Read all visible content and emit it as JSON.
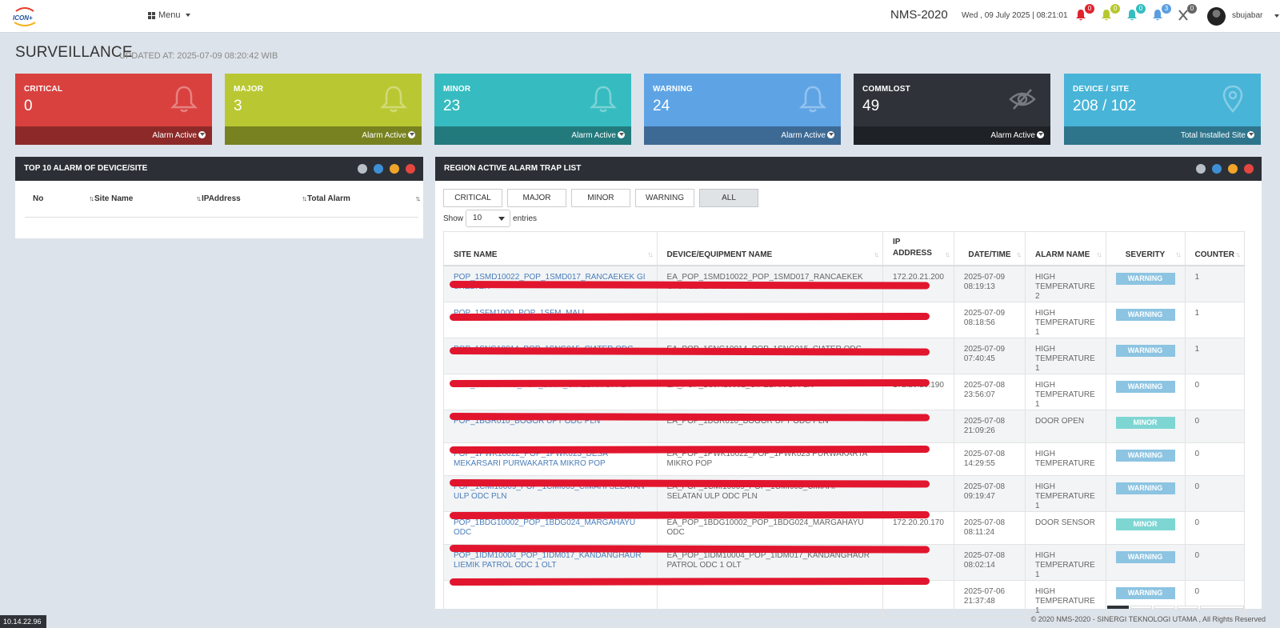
{
  "topbar": {
    "menu_label": "Menu",
    "brand": "NMS-2020",
    "datetime": "Wed , 09 July 2025 | 08:21:01",
    "username": "sbujabar",
    "notifications": [
      {
        "icon": "bell-icon",
        "count": "0",
        "color": "#e0232e"
      },
      {
        "icon": "bell-icon",
        "count": "0",
        "color": "#b7c82e"
      },
      {
        "icon": "bell-icon",
        "count": "0",
        "color": "#35bdc0"
      },
      {
        "icon": "bell-icon",
        "count": "3",
        "color": "#5b9ee0"
      },
      {
        "icon": "commlost-icon",
        "count": "0",
        "color": "#666666"
      }
    ]
  },
  "page": {
    "title": "SURVEILLANCE",
    "updated": "UPDATED AT: 2025-07-09 08:20:42 WIB"
  },
  "cards": [
    {
      "label": "CRITICAL",
      "value": "0",
      "footer": "Alarm Active",
      "color": "#d9413f",
      "icon": "bell-icon"
    },
    {
      "label": "MAJOR",
      "value": "3",
      "footer": "Alarm Active",
      "color": "#b9c832",
      "icon": "bell-icon"
    },
    {
      "label": "MINOR",
      "value": "23",
      "footer": "Alarm Active",
      "color": "#36bcc0",
      "icon": "bell-icon"
    },
    {
      "label": "WARNING",
      "value": "24",
      "footer": "Alarm Active",
      "color": "#5ea4e5",
      "icon": "bell-icon"
    },
    {
      "label": "COMMLOST",
      "value": "49",
      "footer": "Alarm Active",
      "color": "#2f3339",
      "icon": "eye-slash-icon"
    },
    {
      "label": "DEVICE / SITE",
      "value": "208 / 102",
      "footer": "Total Installed Site",
      "color": "#48b4d8",
      "icon": "map-marker-icon"
    }
  ],
  "top10": {
    "title": "TOP 10 ALARM OF DEVICE/SITE",
    "columns": [
      "No",
      "Site Name",
      "IPAddress",
      "Total Alarm"
    ]
  },
  "alarm_panel": {
    "title": "REGION ACTIVE ALARM TRAP LIST",
    "filters": [
      "CRITICAL",
      "MAJOR",
      "MINOR",
      "WARNING",
      "ALL"
    ],
    "active_filter": "ALL",
    "show_label": "Show",
    "entries_value": "10",
    "entries_label": "entries",
    "columns": [
      "SITE NAME",
      "DEVICE/EQUIPMENT NAME",
      "IP ADDRESS",
      "DATE/TIME",
      "ALARM NAME",
      "SEVERITY",
      "COUNTER"
    ],
    "rows": [
      {
        "site": "POP_1SMD10022_POP_1SMD017_RANCAEKEK GI SHELTER",
        "device": "EA_POP_1SMD10022_POP_1SMD017_RANCAEKEK GI SHELTER PLN",
        "ip": "172.20.21.200",
        "date": "2025-07-09",
        "time": "08:19:13",
        "alarm1": "HIGH",
        "alarm2": "TEMPERATURE 2",
        "severity": "WARNING",
        "counter": "1"
      },
      {
        "site": "POP_1SFM1000_POP_1SFM_MALL",
        "device": "",
        "ip": "",
        "date": "2025-07-09",
        "time": "08:18:56",
        "alarm1": "HIGH",
        "alarm2": "TEMPERATURE 1",
        "severity": "WARNING",
        "counter": "1"
      },
      {
        "site": "POP_1SNG10014_POP_1SNG015_CIATER ODC",
        "device": "EA_POP_1SNG10014_POP_1SNG015_CIATER ODC",
        "ip": "",
        "date": "2025-07-09",
        "time": "07:40:45",
        "alarm1": "HIGH",
        "alarm2": "TEMPERATURE 1",
        "severity": "WARNING",
        "counter": "1"
      },
      {
        "site": "POP_1CJR10002_POP_1CJR_CIPEDAK GI PLN",
        "device": "EA_POP_1CJR10002_CIPEDAK GI PLN",
        "ip": "172.20.20.190",
        "date": "2025-07-08",
        "time": "23:56:07",
        "alarm1": "HIGH",
        "alarm2": "TEMPERATURE 1",
        "severity": "WARNING",
        "counter": "0"
      },
      {
        "site": "POP_1BGR010_BOGOR UPT ODC PLN",
        "device": "EA_POP_1BGR010_BOGOR UPT ODC PLN",
        "ip": "",
        "date": "2025-07-08",
        "time": "21:09:26",
        "alarm1": "DOOR OPEN",
        "alarm2": "",
        "severity": "MINOR",
        "counter": "0"
      },
      {
        "site": "POP_1PWK10022_POP_1PWK023_DESA MEKARSARI PURWAKARTA MIKRO POP",
        "device": "EA_POP_1PWK10022_POP_1PWK023 PURWAKARTA MIKRO POP",
        "ip": "",
        "date": "2025-07-08",
        "time": "14:29:55",
        "alarm1": "HIGH",
        "alarm2": "TEMPERATURE",
        "severity": "WARNING",
        "counter": "0"
      },
      {
        "site": "POP_1CMI10009_POP_1CMI005_CIMAHI SELATAN ULP ODC PLN",
        "device": "EA_POP_1CMI10009_POP_1CMI005_CIMAHI SELATAN ULP ODC PLN",
        "ip": "",
        "date": "2025-07-08",
        "time": "09:19:47",
        "alarm1": "HIGH",
        "alarm2": "TEMPERATURE 1",
        "severity": "WARNING",
        "counter": "0"
      },
      {
        "site": "POP_1BDG10002_POP_1BDG024_MARGAHAYU ODC",
        "device": "EA_POP_1BDG10002_POP_1BDG024_MARGAHAYU ODC",
        "ip": "172.20.20.170",
        "date": "2025-07-08",
        "time": "08:11:24",
        "alarm1": "DOOR SENSOR",
        "alarm2": "",
        "severity": "MINOR",
        "counter": "0"
      },
      {
        "site": "POP_1IDM10004_POP_1IDM017_KANDANGHAUR LIEMIK PATROL ODC 1 OLT",
        "device": "EA_POP_1IDM10004_POP_1IDM017_KANDANGHAUR PATROL ODC 1 OLT",
        "ip": "",
        "date": "2025-07-08",
        "time": "08:02:14",
        "alarm1": "HIGH",
        "alarm2": "TEMPERATURE 1",
        "severity": "WARNING",
        "counter": "0"
      },
      {
        "site": "",
        "device": "",
        "ip": "",
        "date": "2025-07-06",
        "time": "21:37:48",
        "alarm1": "HIGH",
        "alarm2": "TEMPERATURE 1",
        "severity": "WARNING",
        "counter": "0"
      }
    ],
    "severity_colors": {
      "WARNING": "#8cc4e2",
      "MINOR": "#7ed6d3"
    }
  },
  "footer": {
    "copyright": "© 2020 NMS-2020 - SINERGI TEKNOLOGI UTAMA , All Rights Reserved",
    "ip": "10.14.22.96"
  }
}
